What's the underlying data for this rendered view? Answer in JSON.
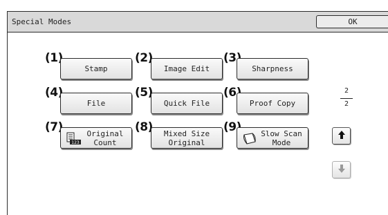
{
  "window": {
    "title": "Special Modes",
    "ok_label": "OK"
  },
  "buttons": [
    {
      "number": "(1)",
      "label": "Stamp"
    },
    {
      "number": "(2)",
      "label": "Image Edit"
    },
    {
      "number": "(3)",
      "label": "Sharpness"
    },
    {
      "number": "(4)",
      "label": "File"
    },
    {
      "number": "(5)",
      "label": "Quick File"
    },
    {
      "number": "(6)",
      "label": "Proof Copy"
    },
    {
      "number": "(7)",
      "label": "Original\nCount",
      "icon": "original-count-icon"
    },
    {
      "number": "(8)",
      "label": "Mixed Size\nOriginal"
    },
    {
      "number": "(9)",
      "label": "Slow Scan\nMode",
      "icon": "slow-scan-icon"
    }
  ],
  "pager": {
    "current": "2",
    "total": "2",
    "up_icon": "up-arrow-icon",
    "down_icon": "down-arrow-icon",
    "down_disabled": true
  }
}
